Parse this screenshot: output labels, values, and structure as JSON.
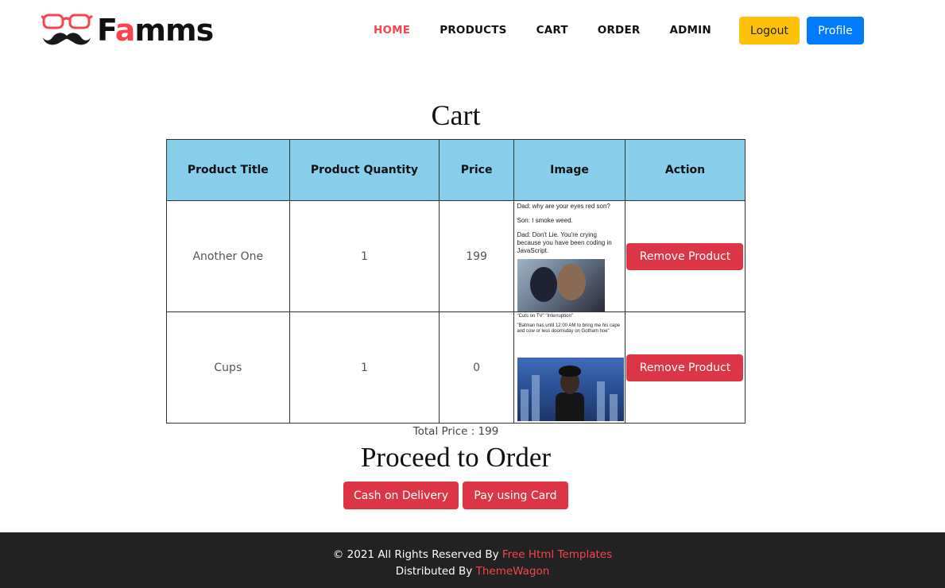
{
  "brand": {
    "name_prefix": "F",
    "name_accent": "a",
    "name_suffix": "mms",
    "accent_color": "#f7444e"
  },
  "nav": {
    "items": [
      {
        "label": "HOME",
        "active": true
      },
      {
        "label": "PRODUCTS",
        "active": false
      },
      {
        "label": "CART",
        "active": false
      },
      {
        "label": "ORDER",
        "active": false
      },
      {
        "label": "ADMIN",
        "active": false
      }
    ],
    "logout_label": "Logout",
    "profile_label": "Profile"
  },
  "cart": {
    "title": "Cart",
    "columns": [
      "Product Title",
      "Product Quantity",
      "Price",
      "Image",
      "Action"
    ],
    "header_color": "#87ceeb",
    "rows": [
      {
        "title": "Another One",
        "quantity": "1",
        "price": "199",
        "image_text": [
          "Dad: why are your eyes red son?",
          "Son: I smoke weed.",
          "Dad: Don't Lie. You're crying because you have been coding in JavaScript."
        ],
        "action_label": "Remove Product"
      },
      {
        "title": "Cups",
        "quantity": "1",
        "price": "0",
        "image_text": [
          "\"Cuts on TV\" \"Interruption\"",
          "\"Batman has until 12:00 AM to bring me his cape and cow or less doomsday on Gotham hoe\""
        ],
        "action_label": "Remove Product"
      }
    ],
    "total_label": "Total Price : 199"
  },
  "order": {
    "title": "Proceed to Order",
    "cod_label": "Cash on Delivery",
    "card_label": "Pay using Card"
  },
  "footer": {
    "line1_text": "© 2021 All Rights Reserved By ",
    "line1_link": "Free Html Templates",
    "line2_text": "Distributed By ",
    "line2_link": "ThemeWagon"
  }
}
